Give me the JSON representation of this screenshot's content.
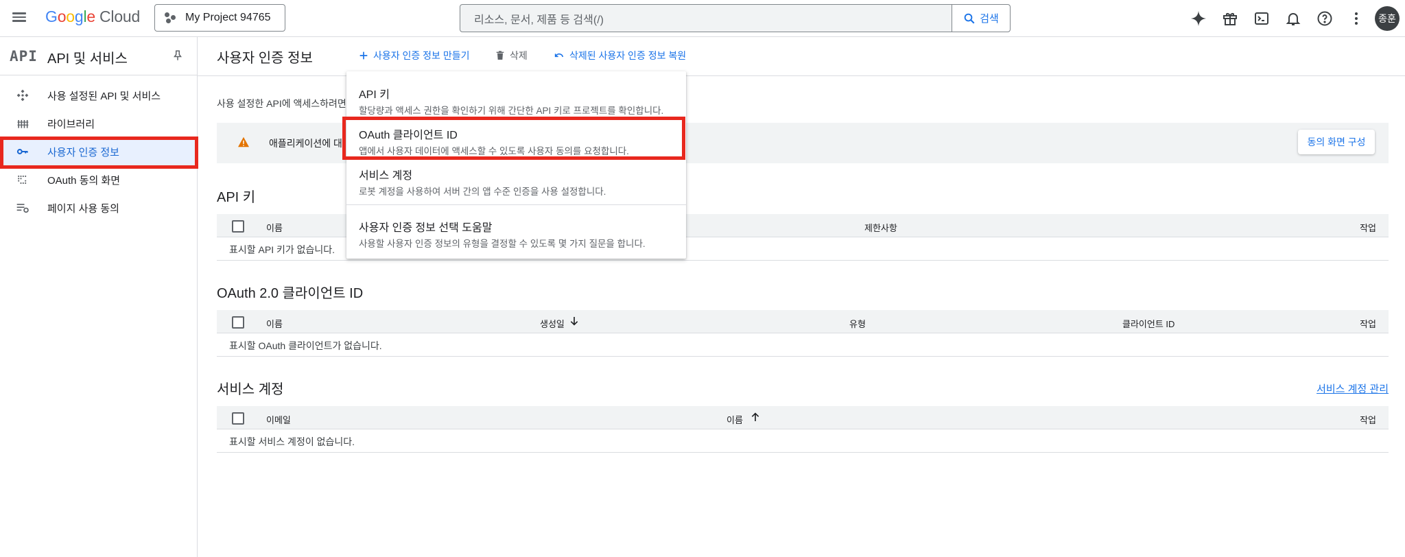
{
  "topbar": {
    "logo": {
      "g": "G",
      "o1": "o",
      "o2": "o",
      "g2": "g",
      "l": "l",
      "e": "e",
      "cloud": "Cloud"
    },
    "project": "My Project 94765",
    "search_placeholder": "리소스, 문서, 제품 등 검색(/)",
    "search_button": "검색",
    "avatar_initials": "종훈",
    "icons": [
      "gemini-icon",
      "gift-icon",
      "terminal-icon",
      "bell-icon",
      "help-icon",
      "more-vert-icon"
    ]
  },
  "sidebar": {
    "logo": "API",
    "title": "API 및 서비스",
    "items": [
      {
        "label": "사용 설정된 API 및 서비스",
        "icon": "api-services-icon"
      },
      {
        "label": "라이브러리",
        "icon": "library-icon"
      },
      {
        "label": "사용자 인증 정보",
        "icon": "key-icon",
        "active": true
      },
      {
        "label": "OAuth 동의 화면",
        "icon": "consent-icon"
      },
      {
        "label": "페이지 사용 동의",
        "icon": "page-usage-icon"
      }
    ]
  },
  "header": {
    "title": "사용자 인증 정보",
    "create": "사용자 인증 정보 만들기",
    "delete": "삭제",
    "restore": "삭제된 사용자 인증 정보 복원"
  },
  "intro": "사용 설정한 API에 액세스하려면",
  "warning": {
    "text": "애플리케이션에 대",
    "button": "동의 화면 구성"
  },
  "api_keys": {
    "title": "API 키",
    "columns": [
      "이름",
      "제한사항",
      "작업"
    ],
    "empty": "표시할 API 키가 없습니다."
  },
  "oauth": {
    "title": "OAuth 2.0 클라이언트 ID",
    "columns": [
      "이름",
      "생성일",
      "유형",
      "클라이언트 ID",
      "작업"
    ],
    "empty": "표시할 OAuth 클라이언트가 없습니다."
  },
  "service_accounts": {
    "title": "서비스 계정",
    "manage": "서비스 계정 관리",
    "columns": [
      "이메일",
      "이름",
      "작업"
    ],
    "empty": "표시할 서비스 계정이 없습니다."
  },
  "menu": {
    "items": [
      {
        "title": "API 키",
        "desc": "할당량과 액세스 권한을 확인하기 위해 간단한 API 키로 프로젝트를 확인합니다."
      },
      {
        "title": "OAuth 클라이언트 ID",
        "desc": "앱에서 사용자 데이터에 액세스할 수 있도록 사용자 동의를 요청합니다."
      },
      {
        "title": "서비스 계정",
        "desc": "로봇 계정을 사용하여 서버 간의 앱 수준 인증을 사용 설정합니다."
      },
      {
        "title": "사용자 인증 정보 선택 도움말",
        "desc": "사용할 사용자 인증 정보의 유형을 결정할 수 있도록 몇 가지 질문을 합니다."
      }
    ]
  },
  "colors": {
    "accent": "#1a73e8",
    "highlight": "#e8281e",
    "warning": "#e37400"
  }
}
